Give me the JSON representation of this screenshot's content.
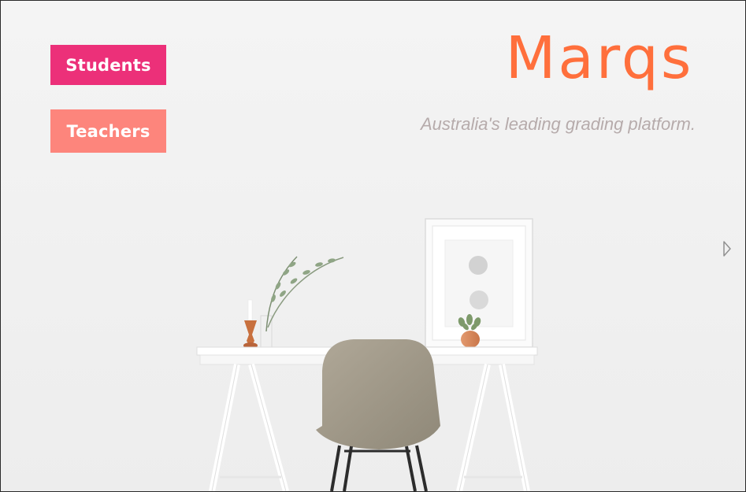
{
  "hero": {
    "brand": "Marqs",
    "tagline": "Australia's leading grading platform."
  },
  "nav": {
    "students_label": "Students",
    "teachers_label": "Teachers"
  },
  "carousel": {
    "next_icon": "chevron-right-icon"
  },
  "colors": {
    "students_button": "#ec3079",
    "teachers_button": "#fd857c",
    "brand": "#ff6f3c",
    "tagline": "#b6abab"
  }
}
